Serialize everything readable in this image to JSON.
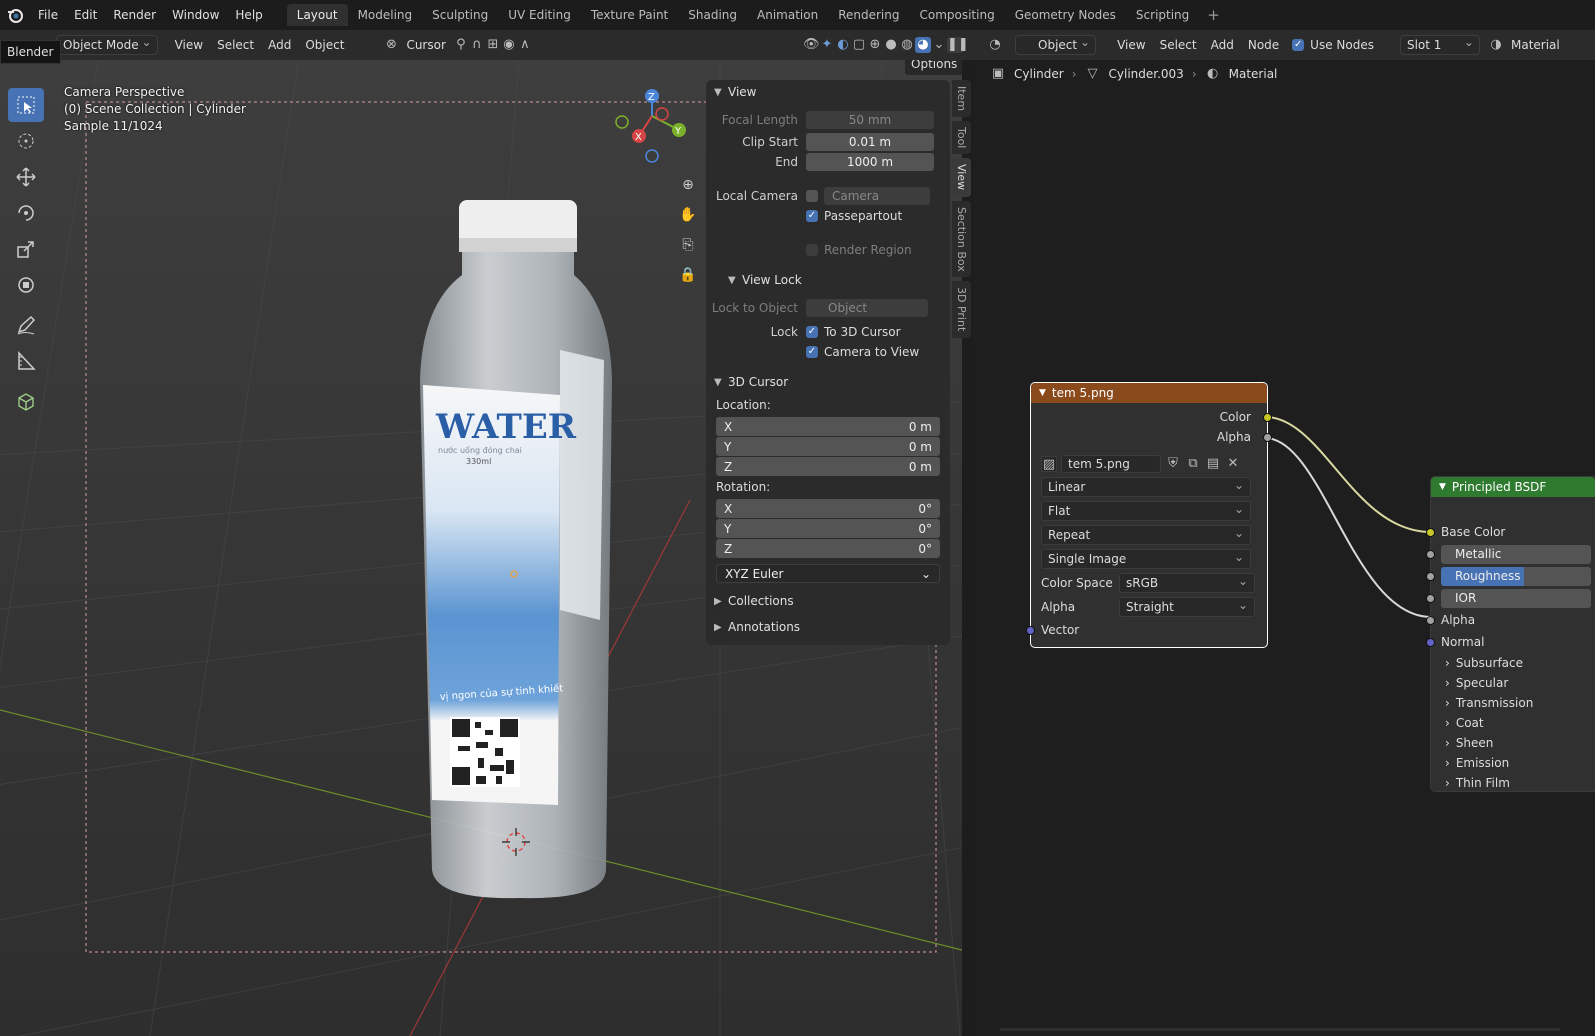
{
  "app": {
    "tooltip": "Blender"
  },
  "menu": [
    "File",
    "Edit",
    "Render",
    "Window",
    "Help"
  ],
  "workspaces": [
    "Layout",
    "Modeling",
    "Sculpting",
    "UV Editing",
    "Texture Paint",
    "Shading",
    "Animation",
    "Rendering",
    "Compositing",
    "Geometry Nodes",
    "Scripting"
  ],
  "workspace_add": "+",
  "view3d_header": {
    "mode": "Object Mode",
    "menus": [
      "View",
      "Select",
      "Add",
      "Object"
    ],
    "pivot": "Cursor",
    "options": "Options"
  },
  "overlay": {
    "line1": "Camera Perspective",
    "line2": "(0) Scene Collection | Cylinder",
    "line3": "Sample 11/1024"
  },
  "gizmo": {
    "x": "X",
    "y": "Y",
    "z": "Z"
  },
  "bottle": {
    "brand": "WATER",
    "sub": "nước uống đóng chai",
    "volume": "330ml",
    "slogan": "vị ngon của sự tinh khiết"
  },
  "npanel": {
    "view": {
      "title": "View",
      "focal_label": "Focal Length",
      "focal_value": "50 mm",
      "clip_start_label": "Clip Start",
      "clip_start_value": "0.01 m",
      "end_label": "End",
      "end_value": "1000 m",
      "local_camera_label": "Local Camera",
      "camera_placeholder": "Camera",
      "passepartout": "Passepartout",
      "render_region": "Render Region"
    },
    "view_lock": {
      "title": "View Lock",
      "lock_to_object_label": "Lock to Object",
      "object_placeholder": "Object",
      "lock_label": "Lock",
      "to_cursor": "To 3D Cursor",
      "camera_to_view": "Camera to View"
    },
    "cursor": {
      "title": "3D Cursor",
      "location_label": "Location:",
      "loc_x_label": "X",
      "loc_x": "0 m",
      "loc_y_label": "Y",
      "loc_y": "0 m",
      "loc_z_label": "Z",
      "loc_z": "0 m",
      "rotation_label": "Rotation:",
      "rot_x_label": "X",
      "rot_x": "0°",
      "rot_y_label": "Y",
      "rot_y": "0°",
      "rot_z_label": "Z",
      "rot_z": "0°",
      "rot_mode": "XYZ Euler"
    },
    "collections": "Collections",
    "annotations": "Annotations"
  },
  "side_tabs": [
    "Item",
    "Tool",
    "View",
    "Section Box",
    "3D Print"
  ],
  "node_header": {
    "object_type": "Object",
    "menus": [
      "View",
      "Select",
      "Add",
      "Node"
    ],
    "use_nodes": "Use Nodes",
    "slot": "Slot 1",
    "material": "Material"
  },
  "breadcrumb": [
    "Cylinder",
    "Cylinder.003",
    "Material"
  ],
  "image_node": {
    "title": "tem 5.png",
    "out_color": "Color",
    "out_alpha": "Alpha",
    "image_name": "tem 5.png",
    "interpolation": "Linear",
    "projection": "Flat",
    "extension": "Repeat",
    "source": "Single Image",
    "color_space_label": "Color Space",
    "color_space": "sRGB",
    "alpha_label": "Alpha",
    "alpha_mode": "Straight",
    "vector": "Vector"
  },
  "bsdf_node": {
    "title": "Principled BSDF",
    "base_color": "Base Color",
    "metallic": "Metallic",
    "roughness": "Roughness",
    "ior": "IOR",
    "alpha": "Alpha",
    "normal": "Normal",
    "panels": [
      "Subsurface",
      "Specular",
      "Transmission",
      "Coat",
      "Sheen",
      "Emission",
      "Thin Film"
    ],
    "roughness_value": 0.55
  },
  "colors": {
    "accent": "#4772b3",
    "image_node_header": "#8a4a1c",
    "bsdf_header": "#2e7a2e",
    "socket_color": "#c7c729",
    "socket_gray": "#a1a1a1",
    "socket_vector": "#6363c7"
  }
}
